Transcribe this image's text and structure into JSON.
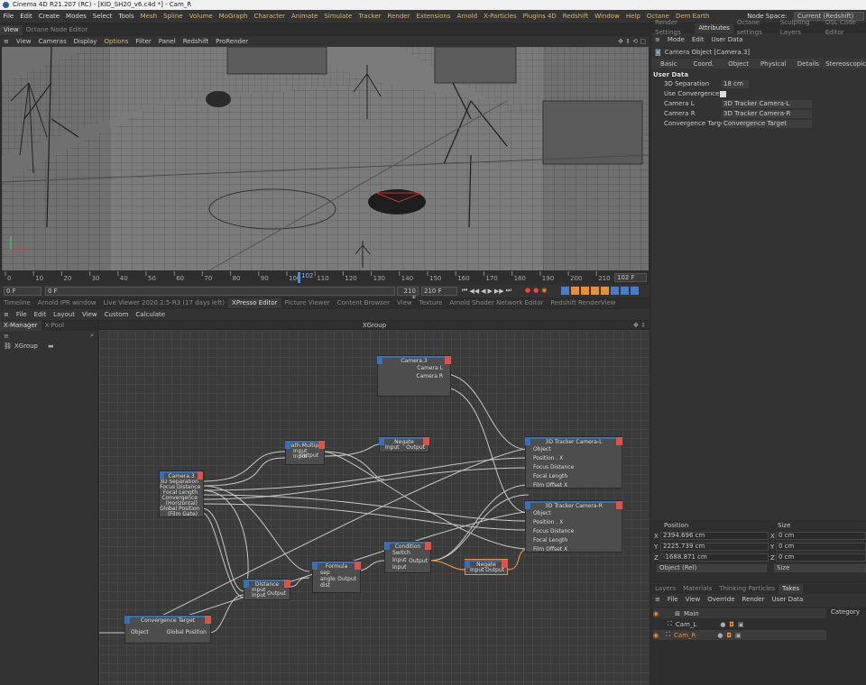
{
  "window": {
    "title": "Cinema 4D R21.207 (RC) - [KID_SH20_v6.c4d *] - Cam_R"
  },
  "menu": [
    "File",
    "Edit",
    "Create",
    "Modes",
    "Select",
    "Tools",
    "Mesh",
    "Spline",
    "Volume",
    "MoGraph",
    "Character",
    "Animate",
    "Simulate",
    "Tracker",
    "Render",
    "Extensions",
    "Arnold",
    "X-Particles",
    "Plugins 4D",
    "Redshift",
    "Window",
    "Help",
    "Octane",
    "Dem Earth"
  ],
  "node_space": {
    "label": "Node Space:",
    "value": "Current (Redshift)"
  },
  "viewport": {
    "tabs": [
      "View",
      "Octane Node Editor"
    ],
    "menu": [
      "View",
      "Cameras",
      "Display",
      "Options",
      "Filter",
      "Panel",
      "Redshift",
      "ProRender"
    ]
  },
  "timeline": {
    "ticks": [
      "0",
      "10",
      "20",
      "30",
      "40",
      "50",
      "60",
      "70",
      "80",
      "90",
      "100",
      "110",
      "120",
      "130",
      "140",
      "150",
      "160",
      "170",
      "180",
      "190",
      "200",
      "210"
    ],
    "current": "102",
    "frame_field": "102 F"
  },
  "transport": {
    "start": "0 F",
    "start2": "0 F",
    "end": "210 F",
    "end2": "210 F"
  },
  "lower_tabs": [
    "Timeline",
    "Arnold IPR window",
    "Live Viewer 2020.2.5-R3 (17 days left)",
    "XPresso Editor",
    "Picture Viewer",
    "Content Browser",
    "View",
    "Texture",
    "Arnold Shader Network Editor",
    "Redshift RenderView"
  ],
  "xpresso_menu": [
    "File",
    "Edit",
    "Layout",
    "View",
    "Custom",
    "Calculate"
  ],
  "xmanager": {
    "tabs": [
      "X-Manager",
      "X-Pool"
    ],
    "item": "XGroup"
  },
  "xgroup": {
    "title": "XGroup"
  },
  "nodes": {
    "camera3_top": {
      "title": "Camera.3",
      "ports": [
        "Camera L",
        "Camera R"
      ]
    },
    "mathmul": {
      "title": "Math:Multiply",
      "in": [
        "Input",
        "Input"
      ],
      "out": "Output"
    },
    "negate1": {
      "title": "Negate",
      "port": "Input",
      "out": "Output"
    },
    "tracker_l": {
      "title": "3D Tracker Camera-L",
      "ports": [
        "Object",
        "Position . X",
        "Focus Distance",
        "Focal Length",
        "Film Offset X"
      ]
    },
    "tracker_r": {
      "title": "3D Tracker Camera-R",
      "ports": [
        "Object",
        "Position . X",
        "Focus Distance",
        "Focal Length",
        "Film Offset X"
      ]
    },
    "camera3": {
      "title": "Camera.3",
      "ports": [
        "3D Separation",
        "Focus Distance",
        "Focal Length",
        "Convergence",
        "(Horizontal)",
        "Global Position",
        "(Film Gate)"
      ]
    },
    "formula": {
      "title": "Formula",
      "in": [
        "sep",
        "angle",
        "dist"
      ],
      "out": "Output"
    },
    "condition": {
      "title": "Condition",
      "in": [
        "Switch",
        "Input",
        "Input"
      ],
      "out": "Output"
    },
    "negate2": {
      "title": "Negate",
      "port": "Input",
      "out": "Output"
    },
    "distance": {
      "title": "Distance",
      "in": [
        "Input",
        "Input"
      ],
      "out": "Output"
    },
    "convergence": {
      "title": "Convergence Target",
      "in": "Object",
      "out": "Global Position"
    }
  },
  "right": {
    "tabs": [
      "Render Settings",
      "Attributes",
      "Octane settings",
      "Sculpting Layers",
      "OSL Code Editor"
    ],
    "menu": [
      "Mode",
      "Edit",
      "User Data"
    ],
    "object": "Camera Object [Camera.3]",
    "subtabs": [
      "Basic",
      "Coord.",
      "Object",
      "Physical",
      "Details",
      "Stereoscopic"
    ],
    "section": "User Data",
    "fields": [
      {
        "label": "3D Separation",
        "value": "18 cm"
      },
      {
        "label": "Use Convergence",
        "value": ""
      },
      {
        "label": "Camera L",
        "value": "3D Tracker Camera-L"
      },
      {
        "label": "Camera R",
        "value": "3D Tracker Camera-R"
      },
      {
        "label": "Convergence Target",
        "value": "Convergence Target"
      }
    ],
    "coords": {
      "pos_label": "Position",
      "size_label": "Size",
      "x": "2394.696 cm",
      "y": "2225.739 cm",
      "z": "-1688.871 cm",
      "sx": "0 cm",
      "sy": "0 cm",
      "sz": "0 cm",
      "mode": "Object (Rel)",
      "size_mode": "Size"
    },
    "layers_tabs": [
      "Layers",
      "Materials",
      "Thinking Particles",
      "Takes"
    ],
    "takes_menu": [
      "File",
      "View",
      "Override",
      "Render",
      "User Data"
    ],
    "category": "Category",
    "takes": [
      "Main",
      "Cam_L",
      "Cam_R"
    ]
  }
}
